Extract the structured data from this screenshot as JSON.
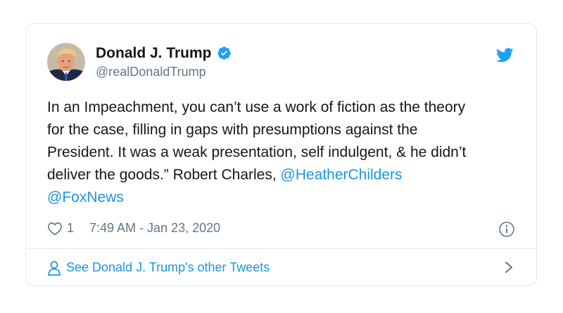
{
  "tweet": {
    "author": {
      "display_name": "Donald J. Trump",
      "handle": "@realDonaldTrump",
      "verified": true
    },
    "text_parts": [
      "In an Impeachment, you can’t use a work of fiction as the theory\nfor the case, filling in gaps with presumptions against the\nPresident. It was a weak presentation, self indulgent, & he didn’t\ndeliver the goods.” Robert Charles, ",
      "\n"
    ],
    "mentions": [
      "@HeatherChilders",
      "@FoxNews"
    ],
    "like_count": "1",
    "timestamp": "7:49 AM - Jan 23, 2020",
    "footer_link": "See Donald J. Trump's other Tweets"
  },
  "icons": {
    "brand": "twitter-bird-icon",
    "verified": "verified-badge-icon",
    "like": "heart-icon",
    "info": "info-icon",
    "profile": "person-icon",
    "chevron": "chevron-right-icon"
  },
  "colors": {
    "accent": "#1b95e0",
    "text": "#14171a",
    "muted": "#657786",
    "border": "#e1e8ed"
  }
}
